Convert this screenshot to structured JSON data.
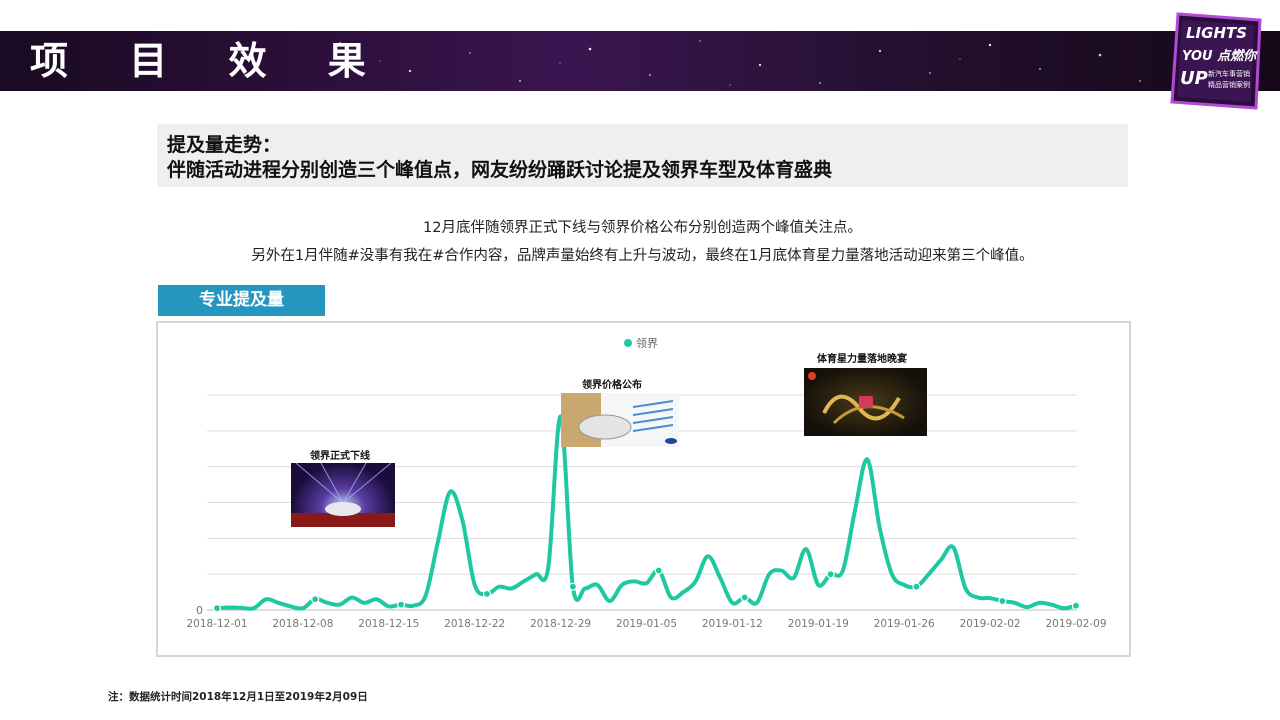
{
  "banner": {
    "title": "项 目 效 果",
    "logo_lines": [
      "LIGHTS",
      "YOU 点燃你",
      "UP",
      "新汽车事营销",
      "精品营销案例"
    ]
  },
  "headline": {
    "line1": "提及量走势：",
    "line2": "伴随活动进程分别创造三个峰值点，网友纷纷踊跃讨论提及领界车型及体育盛典"
  },
  "description": {
    "line1": "12月底伴随领界正式下线与领界价格公布分别创造两个峰值关注点。",
    "line2": "另外在1月伴随#没事有我在#合作内容，品牌声量始终有上升与波动，最终在1月底体育星力量落地活动迎来第三个峰值。"
  },
  "section_label": "专业提及量",
  "annotations": [
    {
      "title": "领界正式下线",
      "image": "launch-event-photo"
    },
    {
      "title": "领界价格公布",
      "image": "price-announcement-card"
    },
    {
      "title": "体育星力量落地晚宴",
      "image": "sports-gala-photo"
    }
  ],
  "footnote": "注：数据统计时间2018年12月1日至2019年2月09日",
  "colors": {
    "line": "#1ec8a0",
    "section_label_bg": "#2596be",
    "banner_bg": "#2c0f3a",
    "headline_bg": "#efefef"
  },
  "chart_data": {
    "type": "line",
    "legend": "领界",
    "legend_position": "top-center",
    "grid": true,
    "y_tick_label": "0",
    "x_tick_labels": [
      "2018-12-01",
      "2018-12-08",
      "2018-12-15",
      "2018-12-22",
      "2018-12-29",
      "2019-01-05",
      "2019-01-12",
      "2019-01-19",
      "2019-01-26",
      "2019-02-02",
      "2019-02-09"
    ],
    "ylim": [
      0,
      6
    ],
    "series": [
      {
        "name": "领界",
        "x": [
          "2018-12-01",
          "2018-12-02",
          "2018-12-03",
          "2018-12-04",
          "2018-12-05",
          "2018-12-06",
          "2018-12-07",
          "2018-12-08",
          "2018-12-09",
          "2018-12-10",
          "2018-12-11",
          "2018-12-12",
          "2018-12-13",
          "2018-12-14",
          "2018-12-15",
          "2018-12-16",
          "2018-12-17",
          "2018-12-18",
          "2018-12-19",
          "2018-12-20",
          "2018-12-21",
          "2018-12-22",
          "2018-12-23",
          "2018-12-24",
          "2018-12-25",
          "2018-12-26",
          "2018-12-27",
          "2018-12-28",
          "2018-12-29",
          "2018-12-30",
          "2018-12-31",
          "2019-01-01",
          "2019-01-02",
          "2019-01-03",
          "2019-01-04",
          "2019-01-05",
          "2019-01-06",
          "2019-01-07",
          "2019-01-08",
          "2019-01-09",
          "2019-01-10",
          "2019-01-11",
          "2019-01-12",
          "2019-01-13",
          "2019-01-14",
          "2019-01-15",
          "2019-01-16",
          "2019-01-17",
          "2019-01-18",
          "2019-01-19",
          "2019-01-20",
          "2019-01-21",
          "2019-01-22",
          "2019-01-23",
          "2019-01-24",
          "2019-01-25",
          "2019-01-26",
          "2019-01-27",
          "2019-01-28",
          "2019-01-29",
          "2019-01-30",
          "2019-01-31",
          "2019-02-01",
          "2019-02-02",
          "2019-02-03",
          "2019-02-04",
          "2019-02-05",
          "2019-02-06",
          "2019-02-07",
          "2019-02-08",
          "2019-02-09"
        ],
        "values": [
          0.05,
          0.07,
          0.06,
          0.05,
          0.3,
          0.2,
          0.1,
          0.05,
          0.3,
          0.2,
          0.15,
          0.35,
          0.2,
          0.3,
          0.1,
          0.15,
          0.12,
          0.4,
          1.9,
          3.3,
          2.5,
          0.7,
          0.45,
          0.65,
          0.6,
          0.8,
          1.0,
          1.2,
          5.4,
          0.65,
          0.6,
          0.7,
          0.25,
          0.7,
          0.8,
          0.75,
          1.1,
          0.35,
          0.5,
          0.8,
          1.5,
          0.9,
          0.2,
          0.35,
          0.2,
          1.0,
          1.1,
          0.9,
          1.7,
          0.7,
          1.0,
          1.1,
          2.8,
          4.2,
          2.3,
          1.0,
          0.7,
          0.65,
          1.0,
          1.4,
          1.75,
          0.6,
          0.35,
          0.33,
          0.25,
          0.2,
          0.08,
          0.2,
          0.15,
          0.05,
          0.12
        ]
      }
    ],
    "markers": [
      "2018-12-01",
      "2018-12-09",
      "2018-12-16",
      "2018-12-23",
      "2018-12-30",
      "2019-01-06",
      "2019-01-13",
      "2019-01-20",
      "2019-01-27",
      "2019-02-03",
      "2019-02-09"
    ]
  }
}
